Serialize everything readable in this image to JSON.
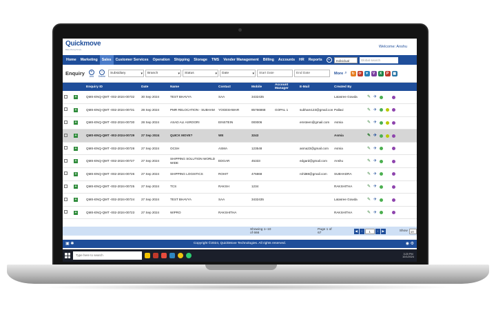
{
  "app": {
    "logo": "Quickmove",
    "tagline": "Make Moving Simple",
    "welcome": "Welcome: Anshu"
  },
  "nav": {
    "items": [
      "Home",
      "Marketing",
      "Sales",
      "Customer Services",
      "Operation",
      "Shipping",
      "Storage",
      "TMS",
      "Vender Management",
      "Billing",
      "Accounts",
      "HR",
      "Reports"
    ],
    "active": "Sales",
    "scope_select": "Individual",
    "global_search_placeholder": "Global search"
  },
  "filters": {
    "title": "Enquiry",
    "add_label": "Add",
    "delete_label": "Delete",
    "subsidiary": "Subsidiary",
    "branch": "Branch",
    "status": "Status",
    "date": "Date",
    "start_date_placeholder": "Start Date",
    "end_date_placeholder": "End Date",
    "more_label": "More"
  },
  "table": {
    "headers": [
      "Enquiry ID",
      "Date",
      "Name",
      "Contact",
      "Mobile",
      "Account Manager",
      "E-Mail",
      "Created By"
    ],
    "rows": [
      {
        "id": "QMS-ENQ-QMT -002-2024-00732",
        "date": "30 Sep 2024",
        "name": "TEST BHAVYA",
        "contact": "SAA",
        "mobile": "3432435",
        "manager": "",
        "email": "",
        "created": "Latasree Gowda",
        "smile": false
      },
      {
        "id": "QMS-ENQ-QMT -002-2024-00731",
        "date": "28 Sep 2024",
        "name": "PMR RELOCATION - SUBHAM",
        "contact": "YOGESHWAR",
        "mobile": "85766868",
        "manager": "GOPAL 1",
        "email": "subham123@gmail.com",
        "created": "Pallavi",
        "smile": true
      },
      {
        "id": "QMS-ENQ-QMT -002-2024-00730",
        "date": "28 Sep 2024",
        "name": "ASAD ALI ASROORI",
        "contact": "EINSTEIN",
        "mobile": "000006",
        "manager": "",
        "email": "emsteen@gmail.com",
        "created": "Asmia",
        "smile": true
      },
      {
        "id": "QMS-ENQ-QMT -002-2024-00729",
        "date": "27 Sep 2024",
        "name": "QUICK MOVE?",
        "contact": "WE",
        "mobile": "3243",
        "manager": "",
        "email": "",
        "created": "Asmia",
        "smile": true
      },
      {
        "id": "QMS-ENQ-QMT -002-2024-00728",
        "date": "27 Sep 2024",
        "name": "OCSH",
        "contact": "ASMA",
        "mobile": "123548",
        "manager": "",
        "email": "asma23@gmail.com",
        "created": "Asmia",
        "smile": false
      },
      {
        "id": "QMS-ENQ-QMT -002-2024-00727",
        "date": "27 Sep 2024",
        "name": "SHIPPING SOLUTION WORLD WIDE",
        "contact": "EDGAR",
        "mobile": "45333",
        "manager": "",
        "email": "edgard@gmail.com",
        "created": "Anshu",
        "smile": false
      },
      {
        "id": "QMS-ENQ-QMT -002-2024-00726",
        "date": "27 Sep 2024",
        "name": "SHIPPING LOGISTICS",
        "contact": "ROHIT",
        "mobile": "476868",
        "manager": "",
        "email": "rohit88@gmail.com",
        "created": "SUBHADRA",
        "smile": false
      },
      {
        "id": "QMS-ENQ-QMT -002-2024-00725",
        "date": "27 Sep 2024",
        "name": "TCS",
        "contact": "RAKSH",
        "mobile": "1234",
        "manager": "",
        "email": "",
        "created": "RAKSHITHA",
        "smile": false
      },
      {
        "id": "QMS-ENQ-QMT -002-2024-00724",
        "date": "27 Sep 2024",
        "name": "TEST BHAVYA",
        "contact": "SAA",
        "mobile": "3432435",
        "manager": "",
        "email": "",
        "created": "Latasree Gowda",
        "smile": false
      },
      {
        "id": "QMS-ENQ-QMT -002-2024-00723",
        "date": "27 Sep 2024",
        "name": "WIPRO",
        "contact": "RAKSHITHA",
        "mobile": "",
        "manager": "",
        "email": "",
        "created": "RAKSHITHA",
        "smile": false
      }
    ],
    "highlight_row": 3
  },
  "pager": {
    "showing": "Showing 1–10 of 666",
    "page_of": "Page 1 of 67",
    "page_input": "1",
    "show_label": "Show",
    "show_value": "10"
  },
  "footer": {
    "copyright": "Copyright ©2024, QuickMove Technologies. All rights reserved."
  },
  "taskbar": {
    "search_placeholder": "Type here to search",
    "time": "3:20 PM",
    "date": "10/1/2024"
  },
  "colors": {
    "nav": "#1f4e9a",
    "active_tab": "#4b7cc9",
    "pager": "#cfe0f5",
    "highlight": "#d6d6d6"
  }
}
